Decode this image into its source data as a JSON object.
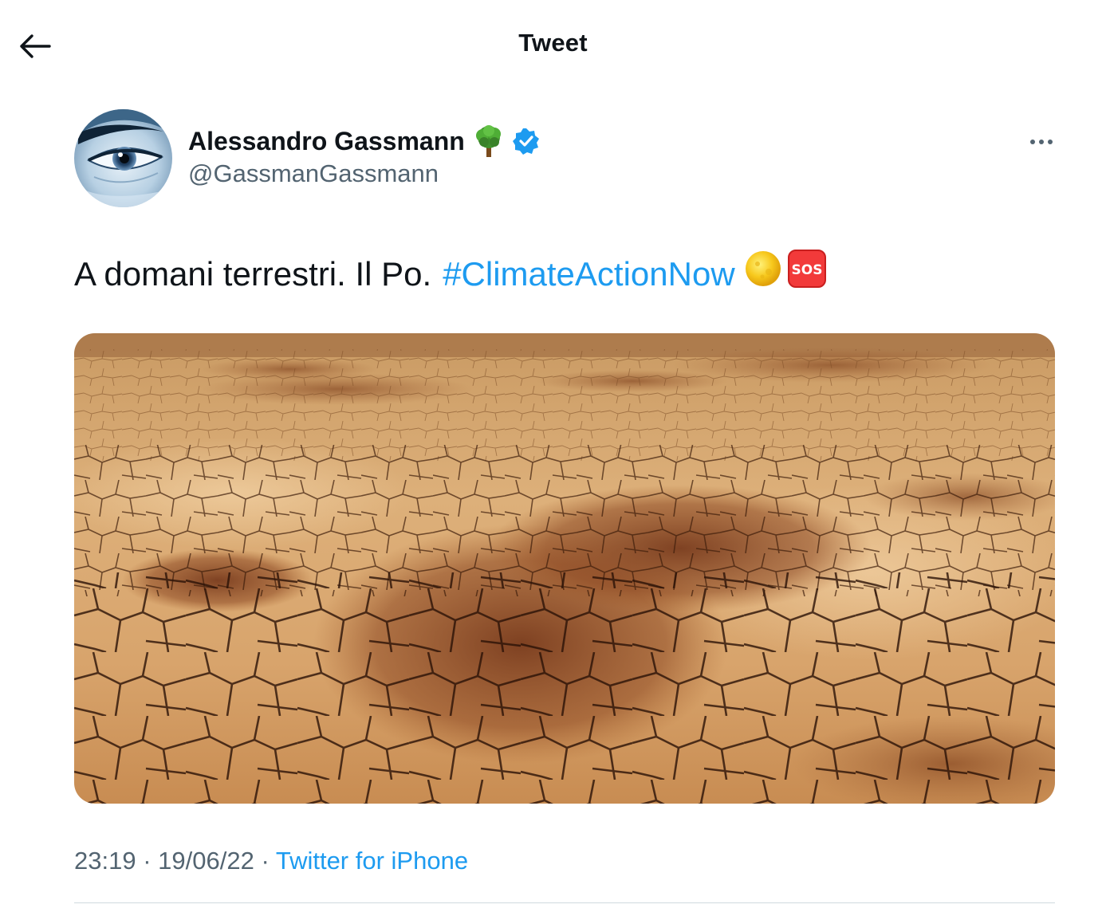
{
  "header": {
    "title": "Tweet",
    "back_icon": "arrow-left-icon"
  },
  "author": {
    "name": "Alessandro Gassmann",
    "handle": "@GassmanGassmann",
    "name_emoji": "tree-emoji",
    "verified": true,
    "verified_color": "#1d9bf0"
  },
  "more_icon": "more-horizontal-icon",
  "tweet": {
    "text": "A domani terrestri. Il Po.",
    "hashtag": "#ClimateActionNow",
    "emojis": [
      "sun-emoji",
      "sos-emoji"
    ],
    "media_description_icon": "dry-cracked-riverbed-photo"
  },
  "meta": {
    "time": "23:19",
    "separator": "·",
    "date": "19/06/22",
    "source": "Twitter for iPhone"
  },
  "colors": {
    "accent": "#1d9bf0",
    "text_primary": "#0f1419",
    "text_secondary": "#536471"
  }
}
